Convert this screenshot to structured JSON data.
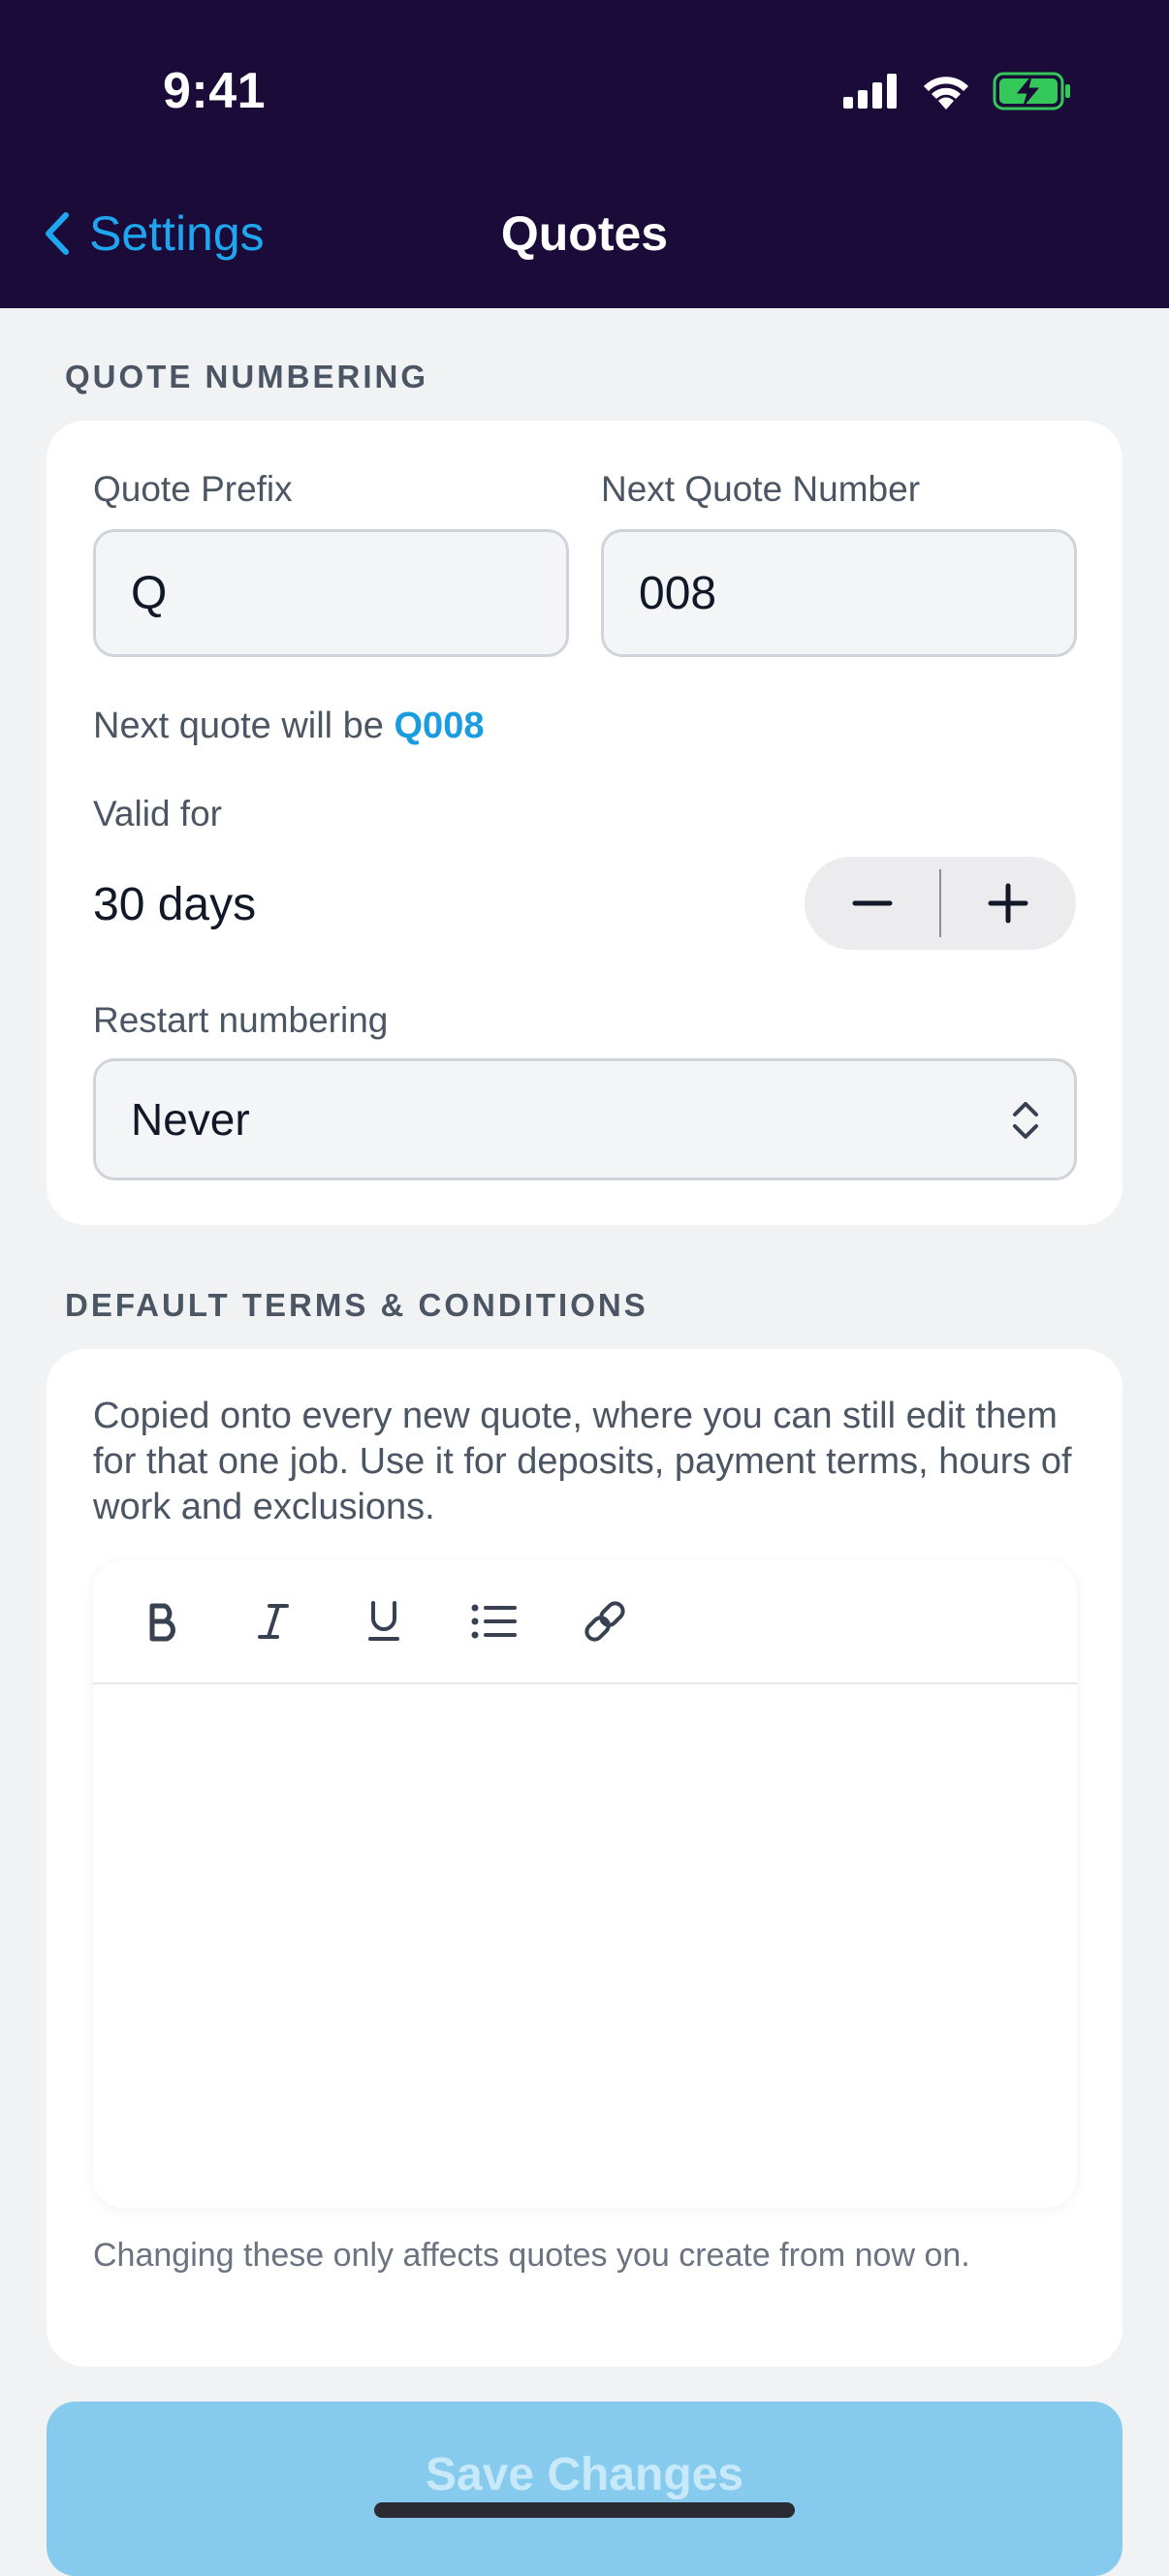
{
  "status_bar": {
    "time": "9:41"
  },
  "nav": {
    "back_label": "Settings",
    "title": "Quotes"
  },
  "numbering": {
    "section_label": "QUOTE NUMBERING",
    "prefix_label": "Quote Prefix",
    "prefix_value": "Q",
    "next_number_label": "Next Quote Number",
    "next_number_value": "008",
    "preview_text": "Next quote will be",
    "preview_value": "Q008",
    "valid_label": "Valid for",
    "valid_value": "30 days",
    "restart_label": "Restart numbering",
    "restart_value": "Never"
  },
  "terms": {
    "section_label": "DEFAULT TERMS & CONDITIONS",
    "description": "Copied onto every new quote, where you can still edit them for that one job. Use it for deposits, payment terms, hours of work and exclusions.",
    "editor_content": "",
    "footnote": "Changing these only affects quotes you create from now on.",
    "toolbar_icons": [
      "bold-icon",
      "italic-icon",
      "underline-icon",
      "bulleted-list-icon",
      "link-icon"
    ]
  },
  "save_button": {
    "label": "Save Changes",
    "color": "#86cbee"
  },
  "colors": {
    "header_bg": "#1b0b38",
    "accent": "#1ea7f0",
    "page_bg": "#f1f2f4",
    "battery_green": "#34c759"
  }
}
